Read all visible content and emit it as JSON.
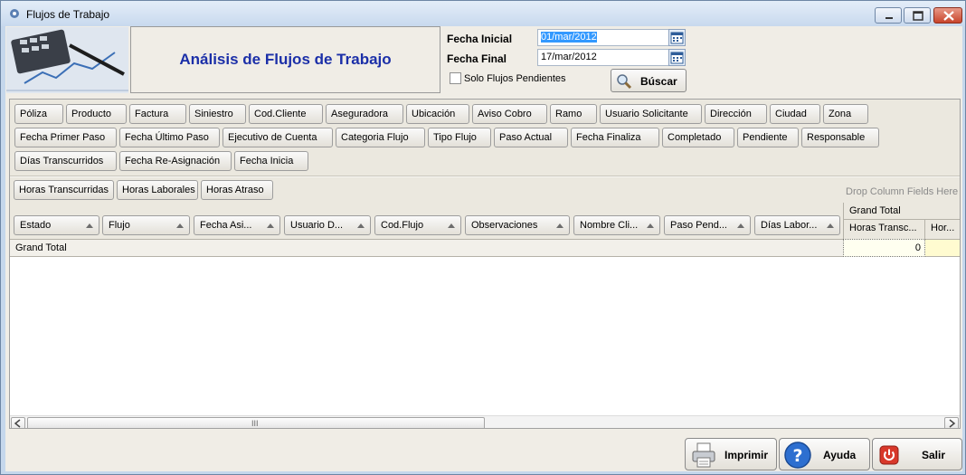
{
  "window": {
    "title": "Flujos de Trabajo"
  },
  "header": {
    "banner_title": "Análisis de Flujos de Trabajo",
    "fecha_inicial_label": "Fecha Inicial",
    "fecha_inicial_value": "01/mar/2012",
    "fecha_final_label": "Fecha Final",
    "fecha_final_value": "17/mar/2012",
    "solo_pendientes_label": "Solo Flujos Pendientes",
    "buscar_label": "Búscar"
  },
  "pivot": {
    "filter_fields": [
      "Póliza",
      "Producto",
      "Factura",
      "Siniestro",
      "Cod.Cliente",
      "Aseguradora",
      "Ubicación",
      "Aviso Cobro",
      "Ramo",
      "Usuario Solicitante",
      "Dirección",
      "Ciudad",
      "Zona",
      "Fecha Primer Paso",
      "Fecha Último Paso",
      "Ejecutivo de Cuenta",
      "Categoria Flujo",
      "Tipo Flujo",
      "Paso Actual",
      "Fecha Finaliza",
      "Completado",
      "Pendiente",
      "Responsable",
      "Días Transcurridos",
      "Fecha Re-Asignación",
      "Fecha Inicia"
    ],
    "data_fields": [
      "Horas Transcurridas",
      "Horas Laborales",
      "Horas Atraso"
    ],
    "drop_hint": "Drop Column Fields Here",
    "row_fields": [
      "Estado",
      "Flujo",
      "Fecha Asi...",
      "Usuario D...",
      "Cod.Flujo",
      "Observaciones",
      "Nombre Cli...",
      "Paso Pend...",
      "Días Labor..."
    ],
    "col_grand_total": "Grand Total",
    "col_headers": [
      "Horas Transc...",
      "Hor..."
    ],
    "grand_total_row_label": "Grand Total",
    "grand_total_values": [
      "0",
      ""
    ],
    "scroll_thumb_glyph": "III"
  },
  "footer": {
    "imprimir_label": "Imprimir",
    "ayuda_label": "Ayuda",
    "salir_label": "Salir"
  }
}
